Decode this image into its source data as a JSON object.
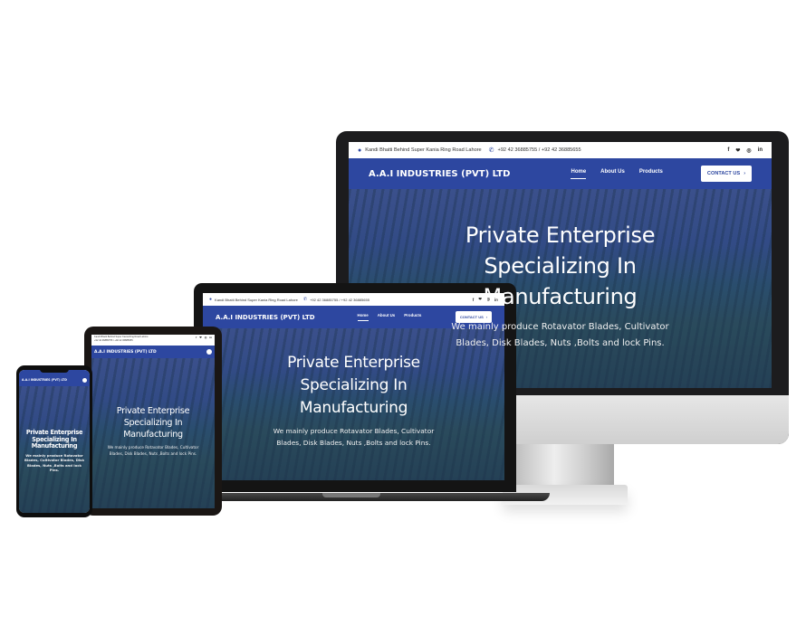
{
  "site": {
    "address": "Kandi Bhatti Behind Super Kania Ring Road Lahore",
    "phone": "+92 42 36885755 / +92 42 36885655",
    "brand": "A.A.I INDUSTRIES (PVT) LTD",
    "nav": [
      "Home",
      "About Us",
      "Products"
    ],
    "cta": "CONTACT US",
    "hero_title_line1": "Private Enterprise",
    "hero_title_line2": "Specializing In",
    "hero_title_line3": "Manufacturing",
    "hero_sub": "We mainly produce Rotavator Blades, Cultivator Blades, Disk Blades, Nuts ,Bolts and lock Pins."
  },
  "icons": {
    "location": "map-marker-icon",
    "phone": "phone-icon",
    "social": [
      "facebook-icon",
      "twitter-icon",
      "instagram-icon",
      "linkedin-icon"
    ],
    "social_glyphs": [
      "f",
      "❤",
      "◎",
      "in"
    ]
  },
  "colors": {
    "navbar": "#2d47a0",
    "hero_overlay": "#263e8c"
  }
}
